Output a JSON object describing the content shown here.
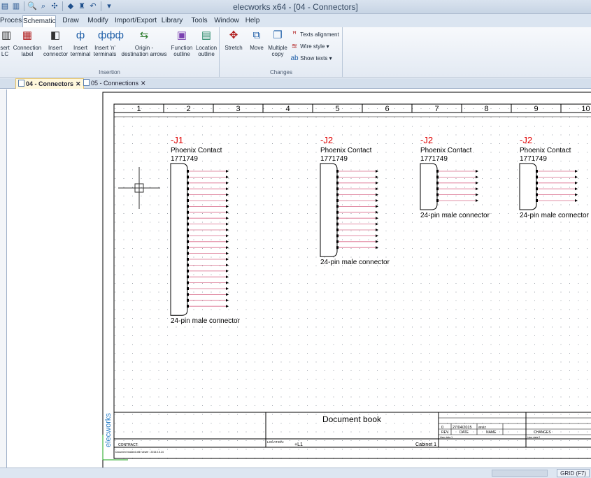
{
  "window": {
    "title": "elecworks x64 - [04 - Connectors]"
  },
  "quick_access": {
    "icons": [
      "new-icon",
      "open-icon",
      "zoom-icon",
      "zoom-fit-icon",
      "pan-icon",
      "run-icon",
      "print-icon",
      "undo-icon",
      "dropdown-icon"
    ]
  },
  "menu": {
    "tabs": [
      "Process",
      "Schematic",
      "Draw",
      "Modify",
      "Import/Export",
      "Library",
      "Tools",
      "Window",
      "Help"
    ],
    "active": "Schematic"
  },
  "ribbon": {
    "insertion": {
      "label": "Insertion",
      "buttons": [
        "sert\nLC",
        "Connection\nlabel",
        "Insert\nconnector",
        "Insert\nterminal",
        "Insert 'n'\nterminals",
        "Origin -\ndestination arrows",
        "Function\noutline",
        "Location\noutline"
      ]
    },
    "changes": {
      "label": "Changes",
      "buttons": [
        "Stretch",
        "Move",
        "Multiple\ncopy"
      ],
      "small_buttons": [
        "Texts alignment",
        "Wire style",
        "Show texts"
      ]
    }
  },
  "documents": {
    "tabs": [
      {
        "label": "04 - Connectors",
        "active": true
      },
      {
        "label": "05 - Connections",
        "active": false
      }
    ]
  },
  "drawing": {
    "columns": [
      "1",
      "2",
      "3",
      "4",
      "5",
      "6",
      "7",
      "8",
      "9",
      "10"
    ],
    "connectors": [
      {
        "tag": "-J1",
        "manufacturer": "Phoenix Contact",
        "reference": "1771749",
        "description": "24-pin male connector",
        "pins": 24
      },
      {
        "tag": "-J2",
        "manufacturer": "Phoenix Contact",
        "reference": "1771749",
        "description": "24-pin male connector",
        "pins": 14
      },
      {
        "tag": "-J2",
        "manufacturer": "Phoenix Contact",
        "reference": "1771749",
        "description": "24-pin male connector",
        "pins": 6
      },
      {
        "tag": "-J2",
        "manufacturer": "Phoenix Contact",
        "reference": "1771749",
        "description": "24-pin male connector",
        "pins": 6
      }
    ],
    "title_block": {
      "document": "Document book",
      "contract_label": "CONTRACT:",
      "location_label": "LOCATION:",
      "location_value": "+L1",
      "cabinet": "Cabinet 1",
      "revision_row": {
        "rev": "0",
        "date": "27/04/2015",
        "name": "aruiz"
      },
      "rev_headers": [
        "REV.",
        "DATE",
        "NAME",
        "CHANGES"
      ],
      "user_data_1": "User data 1",
      "user_data_2": "User data 2",
      "footer_note": "Document realized with viewer : 2015.0.5.24",
      "brand": "elecworks"
    }
  },
  "status": {
    "grid": "GRID (F7)"
  },
  "colors": {
    "accent_red": "#e00000",
    "wire_pink": "#d96b8a",
    "frame": "#000000",
    "ribbon_blue": "#dbe5f1"
  }
}
